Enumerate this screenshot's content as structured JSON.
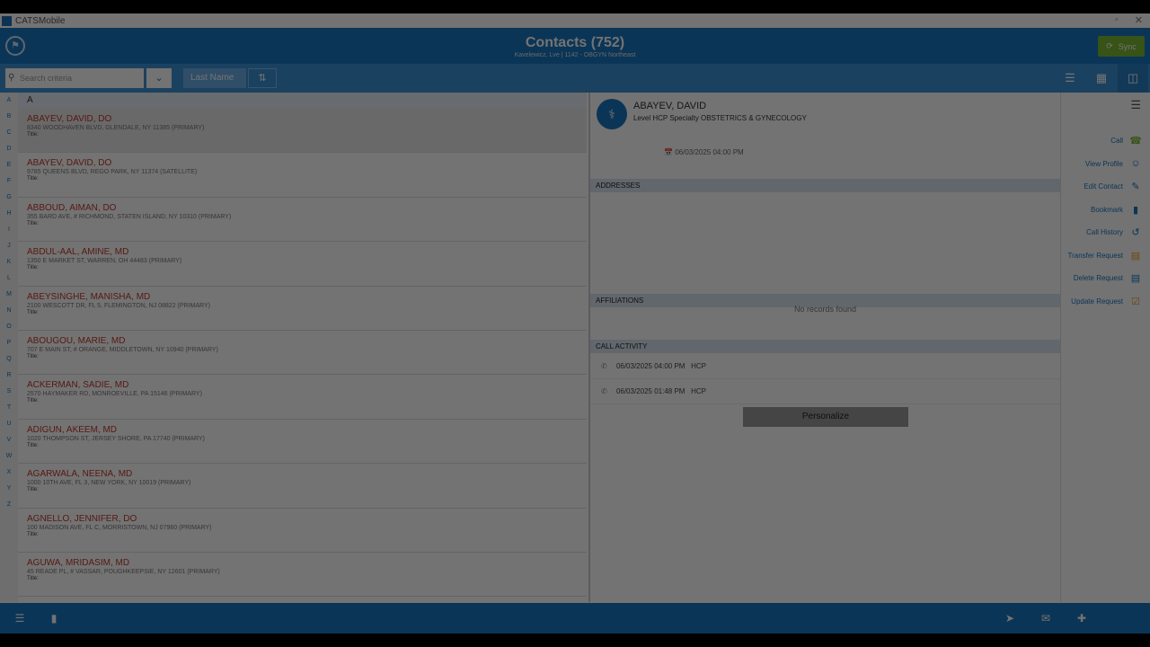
{
  "window": {
    "title": "CATSMobile",
    "icon": "app-icon"
  },
  "header": {
    "title": "Contacts (752)",
    "subtitle": "Kavelewicz, Lve | 1142 - OBGYN Northeast",
    "sync_label": "Sync",
    "colors": {
      "primary": "#1a75bf",
      "accent": "#7bb834"
    }
  },
  "toolbar": {
    "search_placeholder": "Search criteria",
    "sort_field": "Last Name"
  },
  "alphabet": [
    "A",
    "B",
    "C",
    "D",
    "E",
    "F",
    "G",
    "H",
    "I",
    "J",
    "K",
    "L",
    "M",
    "N",
    "O",
    "P",
    "Q",
    "R",
    "S",
    "T",
    "U",
    "V",
    "W",
    "X",
    "Y",
    "Z"
  ],
  "list": {
    "section_letter": "A",
    "contacts": [
      {
        "name": "ABAYEV, DAVID, DO",
        "address": "8340 WOODHAVEN BLVD, GLENDALE, NY 11385 (PRIMARY)",
        "title": "Title:"
      },
      {
        "name": "ABAYEV, DAVID, DO",
        "address": "9785 QUEENS BLVD, REGO PARK, NY 11374 (SATELLITE)",
        "title": "Title:"
      },
      {
        "name": "ABBOUD, AIMAN, DO",
        "address": "355 BARD AVE, # RICHMOND, STATEN ISLAND, NY 10310 (PRIMARY)",
        "title": "Title:"
      },
      {
        "name": "ABDUL-AAL, AMINE, MD",
        "address": "1350 E MARKET ST, WARREN, OH 44483 (PRIMARY)",
        "title": "Title:"
      },
      {
        "name": "ABEYSINGHE, MANISHA, MD",
        "address": "2100 WESCOTT DR, FL 5, FLEMINGTON, NJ 08822 (PRIMARY)",
        "title": "Title:"
      },
      {
        "name": "ABOUGOU, MARIE, MD",
        "address": "707 E MAIN ST, # ORANGE, MIDDLETOWN, NY 10940 (PRIMARY)",
        "title": "Title:"
      },
      {
        "name": "ACKERMAN, SADIE, MD",
        "address": "2570 HAYMAKER RD, MONROEVILLE, PA 15146 (PRIMARY)",
        "title": "Title:"
      },
      {
        "name": "ADIGUN, AKEEM, MD",
        "address": "1020 THOMPSON ST, JERSEY SHORE, PA 17740 (PRIMARY)",
        "title": "Title:"
      },
      {
        "name": "AGARWALA, NEENA, MD",
        "address": "1000 10TH AVE, FL 3, NEW YORK, NY 10019 (PRIMARY)",
        "title": "Title:"
      },
      {
        "name": "AGNELLO, JENNIFER, DO",
        "address": "100 MADISON AVE, FL C, MORRISTOWN, NJ 07960 (PRIMARY)",
        "title": "Title:"
      },
      {
        "name": "AGUWA, MRIDASIM, MD",
        "address": "45 READE PL, # VASSAR, POUGHKEEPSIE, NY 12601 (PRIMARY)",
        "title": "Title:"
      }
    ]
  },
  "detail": {
    "name": "ABAYEV, DAVID",
    "info": "Level HCP  Specialty OBSTETRICS & GYNECOLOGY",
    "date": "06/03/2025 04:00 PM",
    "sections": {
      "addresses": "ADDRESSES",
      "affiliations": "AFFILIATIONS",
      "call_activity": "CALL ACTIVITY"
    },
    "no_records": "No records found",
    "activities": [
      {
        "datetime": "06/03/2025 04:00 PM",
        "type": "HCP"
      },
      {
        "datetime": "06/03/2025 01:48 PM",
        "type": "HCP"
      }
    ],
    "personalize_label": "Personalize"
  },
  "actions": [
    {
      "label": "Call",
      "icon": "phone-icon",
      "color": "#7bb834"
    },
    {
      "label": "View Profile",
      "icon": "person-icon",
      "color": "#1a75bf"
    },
    {
      "label": "Edit Contact",
      "icon": "pencil-icon",
      "color": "#1a75bf"
    },
    {
      "label": "Bookmark",
      "icon": "bookmark-icon",
      "color": "#1a75bf"
    },
    {
      "label": "Call History",
      "icon": "history-icon",
      "color": "#1a75bf"
    },
    {
      "label": "Transfer Request",
      "icon": "transfer-card-icon",
      "color": "#e6a020"
    },
    {
      "label": "Delete Request",
      "icon": "delete-card-icon",
      "color": "#1a75bf"
    },
    {
      "label": "Update Request",
      "icon": "update-card-icon",
      "color": "#e6a020"
    }
  ]
}
